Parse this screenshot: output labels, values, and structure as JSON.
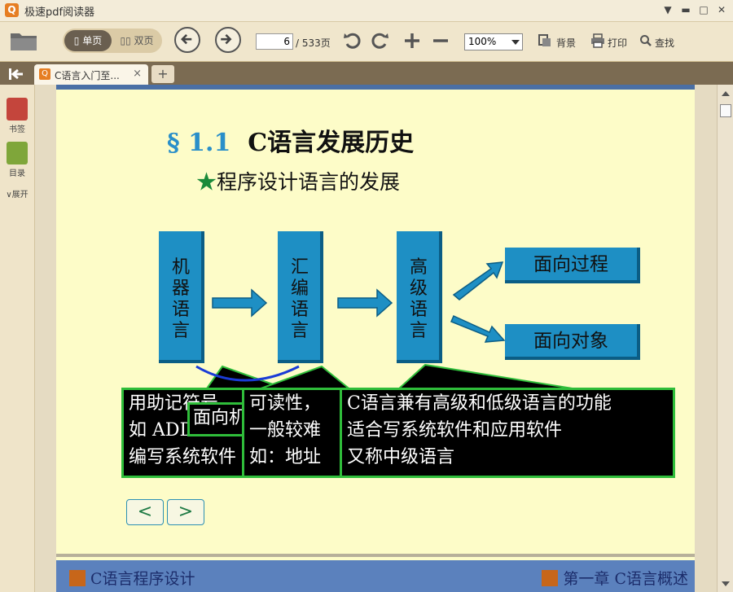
{
  "window": {
    "title": "极速pdf阅读器"
  },
  "toolbar": {
    "single_page": "单页",
    "double_page": "双页",
    "current_page": "6",
    "total_pages": "/ 533页",
    "zoom": "100%",
    "background": "背景",
    "print": "打印",
    "find": "查找"
  },
  "tabs": [
    {
      "label": "C语言入门至...",
      "close": "×"
    }
  ],
  "tab_add": "+",
  "sidebar": {
    "bookmarks": "书签",
    "contents": "目录",
    "expand": "展开"
  },
  "slide": {
    "section_num": "§ 1.1",
    "title": "C语言发展历史",
    "subtitle_star": "★",
    "subtitle": "程序设计语言的发展",
    "boxes": [
      "机器语言",
      "汇编语言",
      "高级语言"
    ],
    "outcomes": [
      "面向过程",
      "面向对象"
    ],
    "popup1": [
      "用助记符号",
      "如 ADD",
      "编写系统软件"
    ],
    "popup_small": "面向机",
    "popup2": [
      "可读性，",
      "一般较难",
      "如：地址"
    ],
    "popup3": [
      "C语言兼有高级和低级语言的功能",
      "适合写系统软件和应用软件",
      "又称中级语言"
    ],
    "nav_prev": "<",
    "nav_next": ">",
    "footer_left": "C语言程序设计",
    "footer_right": "第一章 C语言概述"
  },
  "colors": {
    "box_blue": "#1e8fc4",
    "popup_border": "#2fbd3a",
    "page_bg": "#fdfcc8"
  }
}
